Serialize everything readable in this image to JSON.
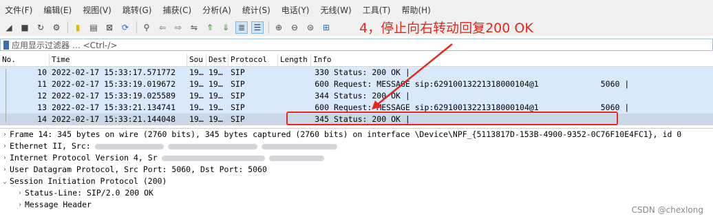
{
  "menu": [
    "文件(F)",
    "编辑(E)",
    "视图(V)",
    "跳转(G)",
    "捕获(C)",
    "分析(A)",
    "统计(S)",
    "电话(Y)",
    "无线(W)",
    "工具(T)",
    "帮助(H)"
  ],
  "toolbar": {
    "icons": [
      "fin-icon",
      "stop-icon",
      "restart-icon",
      "options-icon",
      "open-file-icon",
      "save-icon",
      "close-file-icon",
      "reload-icon",
      "find-icon",
      "go-back-icon",
      "go-forward-icon",
      "go-to-packet-icon",
      "first-packet-icon",
      "last-packet-icon",
      "autoscroll-icon",
      "colorize-icon",
      "zoom-in-icon",
      "zoom-out-icon",
      "normal-size-icon",
      "resize-columns-icon"
    ]
  },
  "annotation": "4，停止向右转动回复200 OK",
  "filter": {
    "placeholder": "应用显示过滤器 … <Ctrl-/>"
  },
  "packet_list": {
    "columns": [
      "No.",
      "Time",
      "Sou",
      "Dest",
      "Protocol",
      "Length",
      "Info"
    ],
    "rows": [
      {
        "no": "10",
        "time": "2022-02-17 15:33:17.571772",
        "src": "19…",
        "dst": "19…",
        "proto": "SIP",
        "len": "330",
        "info": "Status: 200 OK |"
      },
      {
        "no": "11",
        "time": "2022-02-17 15:33:19.019672",
        "src": "19…",
        "dst": "19…",
        "proto": "SIP",
        "len": "600",
        "info": "Request: MESSAGE sip:62910013221318000104@1             5060 |"
      },
      {
        "no": "12",
        "time": "2022-02-17 15:33:19.025589",
        "src": "19…",
        "dst": "19…",
        "proto": "SIP",
        "len": "344",
        "info": "Status: 200 OK |"
      },
      {
        "no": "13",
        "time": "2022-02-17 15:33:21.134741",
        "src": "19…",
        "dst": "19…",
        "proto": "SIP",
        "len": "600",
        "info": "Request: MESSAGE sip:62910013221318000104@1             5060 |"
      },
      {
        "no": "14",
        "time": "2022-02-17 15:33:21.144048",
        "src": "19…",
        "dst": "19…",
        "proto": "SIP",
        "len": "345",
        "info": "Status: 200 OK |"
      }
    ],
    "selected_no": "14"
  },
  "details": {
    "frame": "Frame 14: 345 bytes on wire (2760 bits), 345 bytes captured (2760 bits) on interface \\Device\\NPF_{5113817D-153B-4900-9352-0C76F10E4FC1}, id 0",
    "ethernet": "Ethernet II, Src:",
    "ip": "Internet Protocol Version 4, Sr",
    "udp": "User Datagram Protocol, Src Port: 5060, Dst Port: 5060",
    "sip": "Session Initiation Protocol (200)",
    "status_line": "Status-Line: SIP/2.0 200 OK",
    "message_header": "Message Header"
  },
  "watermark": "CSDN @chexlong",
  "colors": {
    "row_bg": "#dae8fc",
    "row_selected": "#c9d7e6",
    "annotation_red": "#e5271a"
  }
}
